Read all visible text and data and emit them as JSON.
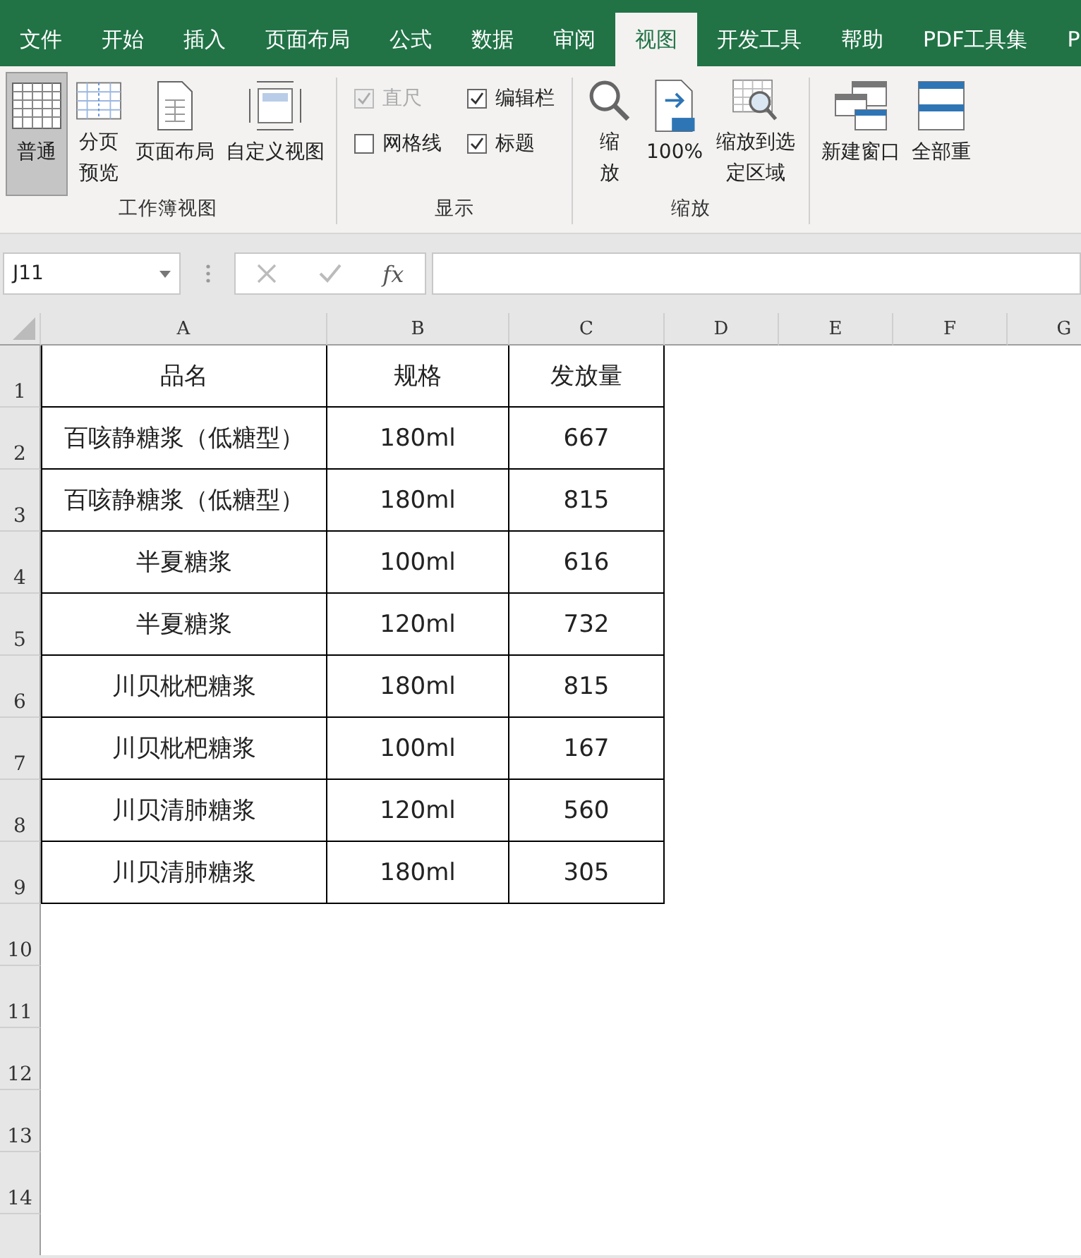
{
  "tabs": [
    {
      "label": "文件",
      "selected": false
    },
    {
      "label": "开始",
      "selected": false
    },
    {
      "label": "插入",
      "selected": false
    },
    {
      "label": "页面布局",
      "selected": false
    },
    {
      "label": "公式",
      "selected": false
    },
    {
      "label": "数据",
      "selected": false
    },
    {
      "label": "审阅",
      "selected": false
    },
    {
      "label": "视图",
      "selected": true
    },
    {
      "label": "开发工具",
      "selected": false
    },
    {
      "label": "帮助",
      "selected": false
    },
    {
      "label": "PDF工具集",
      "selected": false
    },
    {
      "label": "P",
      "selected": false
    }
  ],
  "ribbon": {
    "groups": [
      {
        "label": "工作簿视图",
        "kind": "buttons",
        "buttons": [
          {
            "label": "普通",
            "selected": true
          },
          {
            "label": "分页预览",
            "selected": false
          },
          {
            "label": "页面布局",
            "selected": false
          },
          {
            "label": "自定义视图",
            "selected": false
          }
        ]
      },
      {
        "label": "显示",
        "kind": "checks",
        "checks": [
          {
            "label": "直尺",
            "checked": true,
            "disabled": true
          },
          {
            "label": "编辑栏",
            "checked": true,
            "disabled": false
          },
          {
            "label": "网格线",
            "checked": false,
            "disabled": false
          },
          {
            "label": "标题",
            "checked": true,
            "disabled": false
          }
        ]
      },
      {
        "label": "缩放",
        "kind": "buttons",
        "buttons": [
          {
            "label": "缩放",
            "selected": false
          },
          {
            "label": "100%",
            "selected": false
          },
          {
            "label": "缩放到选定区域",
            "selected": false
          }
        ]
      },
      {
        "kind": "buttons",
        "buttons": [
          {
            "label": "新建窗口",
            "selected": false
          },
          {
            "label": "全部重",
            "selected": false
          }
        ]
      }
    ]
  },
  "formula_bar": {
    "name_box": "J11",
    "fx": "fx"
  },
  "sheet": {
    "columns": [
      "A",
      "B",
      "C",
      "D",
      "E",
      "F",
      "G"
    ],
    "rows": [
      "1",
      "2",
      "3",
      "4",
      "5",
      "6",
      "7",
      "8",
      "9",
      "10",
      "11",
      "12",
      "13",
      "14"
    ],
    "table": [
      [
        "品名",
        "规格",
        "发放量"
      ],
      [
        "百咳静糖浆（低糖型）",
        "180ml",
        "667"
      ],
      [
        "百咳静糖浆（低糖型）",
        "180ml",
        "815"
      ],
      [
        "半夏糖浆",
        "100ml",
        "616"
      ],
      [
        "半夏糖浆",
        "120ml",
        "732"
      ],
      [
        "川贝枇杷糖浆",
        "180ml",
        "815"
      ],
      [
        "川贝枇杷糖浆",
        "100ml",
        "167"
      ],
      [
        "川贝清肺糖浆",
        "120ml",
        "560"
      ],
      [
        "川贝清肺糖浆",
        "180ml",
        "305"
      ]
    ]
  }
}
